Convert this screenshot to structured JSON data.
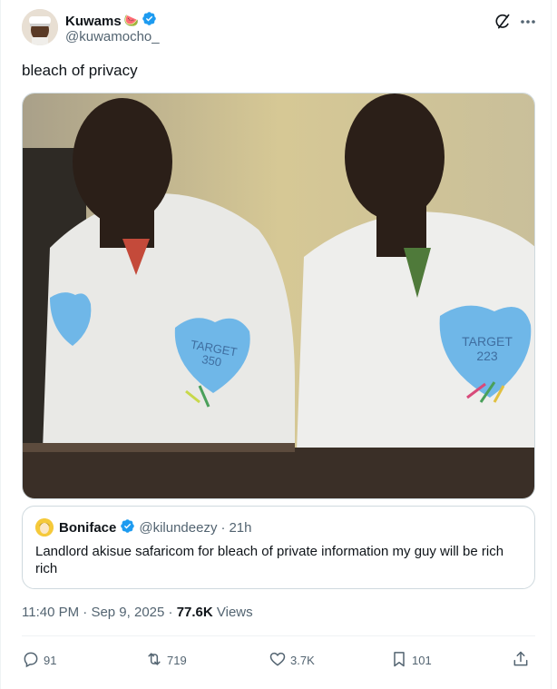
{
  "post": {
    "author": {
      "display_name": "Kuwams",
      "name_emoji": "🍉",
      "handle": "@kuwamocho_",
      "verified": true
    },
    "text": "bleach of privacy",
    "photo": {
      "badge_left": "TARGET\n350",
      "badge_right": "TARGET\n223"
    },
    "quote": {
      "display_name": "Boniface",
      "verified": true,
      "handle": "@kilundeezy",
      "separator": "·",
      "age": "21h",
      "text": "Landlord akisue safaricom for bleach of private information my guy will be rich rich"
    },
    "timestamp": {
      "time": "11:40 PM",
      "separator": "·",
      "date": "Sep 9, 2025",
      "views_count": "77.6K",
      "views_label": "Views"
    },
    "actions": {
      "replies": "91",
      "reposts": "719",
      "likes": "3.7K",
      "bookmarks": "101"
    },
    "icons": {
      "verified": "verified-badge-icon",
      "grok": "grok-icon",
      "more": "more-icon",
      "reply": "reply-icon",
      "repost": "repost-icon",
      "like": "heart-icon",
      "bookmark": "bookmark-icon",
      "share": "share-icon"
    },
    "colors": {
      "verified": "#1d9bf0",
      "text_primary": "#0f1419",
      "text_secondary": "#536471",
      "border": "#cfd9de"
    }
  }
}
